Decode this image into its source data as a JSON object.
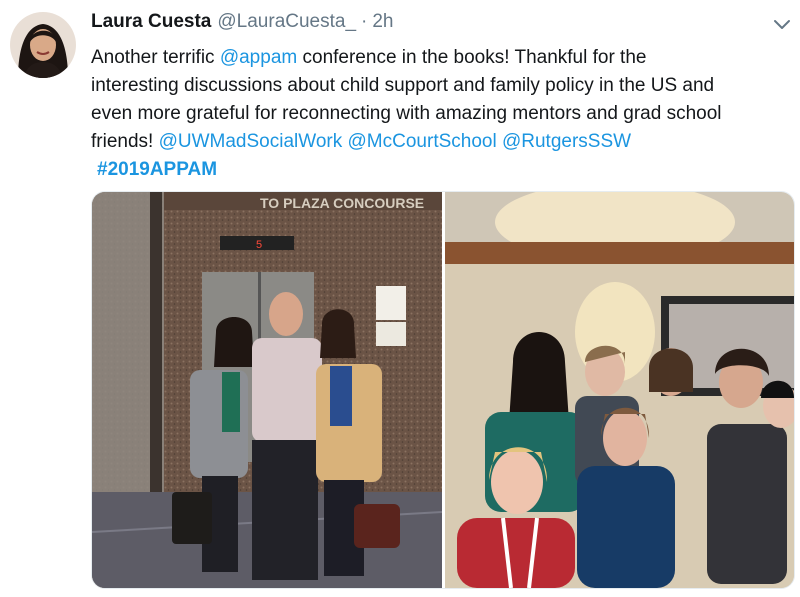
{
  "author": {
    "name": "Laura Cuesta",
    "handle": "@LauraCuesta_",
    "separator": "·",
    "time": "2h",
    "avatar_icon": "profile-photo"
  },
  "tweet": {
    "line1_prefix": "Another terrific ",
    "line1_mention": "@appam",
    "line1_suffix": " conference in the books! Thankful for the",
    "line2": "interesting discussions about child support and family policy in the US and",
    "line3": "even more grateful for reconnecting with amazing mentors and grad school",
    "line4_prefix": "friends! ",
    "mentions": [
      "@UWMadSocialWork",
      "@McCourtSchool",
      "@RutgersSSW"
    ],
    "hashtag": "#2019APPAM"
  },
  "media": {
    "left_photo_sign": "TO PLAZA CONCOURSE",
    "left_photo_floor": "5",
    "left_photo_icon": "elevator-photo",
    "right_photo_icon": "group-photo"
  },
  "colors": {
    "link": "#1b95e0",
    "text": "#14171a",
    "muted": "#657786"
  },
  "menu_icon": "chevron-down-icon"
}
